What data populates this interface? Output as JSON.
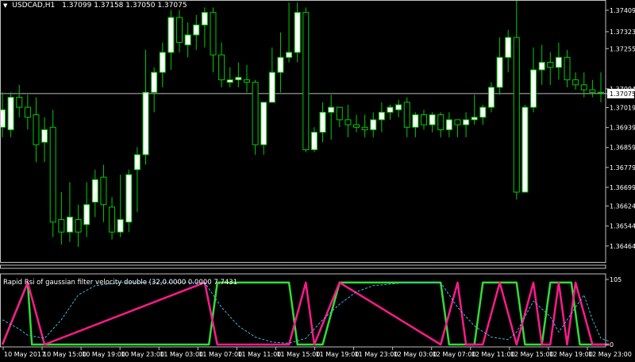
{
  "header": {
    "symbol": "USDCAD,H1",
    "ohlc": "1.37099 1.37158 1.37050 1.37075"
  },
  "indicator": {
    "title": "Rapid Rsi of gaussian filter velocity double (32,0.0000 0.0000 7.7431"
  },
  "colors": {
    "background": "#000000",
    "bull_candle": "#ffffff",
    "bear_candle": "#000000",
    "wick": "#00cc00",
    "rsi_up": "#33dd33",
    "rsi_down": "#ff1a8c",
    "signal": "#3fb7d9",
    "grid": "#c0c0c0"
  },
  "chart_data": [
    {
      "type": "candlestick",
      "title": "USDCAD,H1",
      "ylim": [
        1.364,
        1.3745
      ],
      "yticks": [
        "1.37409",
        "1.37323",
        "1.37255",
        "1.37094",
        "1.37075",
        "1.37019",
        "1.36939",
        "1.36859",
        "1.36779",
        "1.36699",
        "1.36624",
        "1.36544",
        "1.36464"
      ],
      "current_price": "1.37075",
      "xticks": [
        "10 May 2017",
        "10 May 15:00",
        "10 May 19:00",
        "10 May 23:00",
        "11 May 03:00",
        "11 May 07:00",
        "11 May 11:00",
        "11 May 15:00",
        "11 May 19:00",
        "11 May 23:00",
        "12 May 03:00",
        "12 May 07:00",
        "12 May 11:00",
        "12 May 15:00",
        "12 May 19:00",
        "12 May 23:00"
      ],
      "candles": [
        {
          "o": 1.3694,
          "h": 1.3708,
          "l": 1.369,
          "c": 1.3701
        },
        {
          "o": 1.3693,
          "h": 1.3708,
          "l": 1.369,
          "c": 1.3706
        },
        {
          "o": 1.3706,
          "h": 1.3711,
          "l": 1.3698,
          "c": 1.3702
        },
        {
          "o": 1.3702,
          "h": 1.3707,
          "l": 1.3693,
          "c": 1.3698
        },
        {
          "o": 1.3699,
          "h": 1.3706,
          "l": 1.368,
          "c": 1.3687
        },
        {
          "o": 1.3688,
          "h": 1.3698,
          "l": 1.368,
          "c": 1.3693
        },
        {
          "o": 1.3694,
          "h": 1.3701,
          "l": 1.365,
          "c": 1.3656
        },
        {
          "o": 1.3657,
          "h": 1.3668,
          "l": 1.3647,
          "c": 1.3652
        },
        {
          "o": 1.3652,
          "h": 1.3672,
          "l": 1.3648,
          "c": 1.3658
        },
        {
          "o": 1.3657,
          "h": 1.3663,
          "l": 1.3646,
          "c": 1.3652
        },
        {
          "o": 1.3655,
          "h": 1.3672,
          "l": 1.365,
          "c": 1.3663
        },
        {
          "o": 1.3664,
          "h": 1.3677,
          "l": 1.3658,
          "c": 1.3673
        },
        {
          "o": 1.3674,
          "h": 1.3679,
          "l": 1.3656,
          "c": 1.3663
        },
        {
          "o": 1.3662,
          "h": 1.3666,
          "l": 1.3649,
          "c": 1.3652
        },
        {
          "o": 1.3652,
          "h": 1.3675,
          "l": 1.365,
          "c": 1.3657
        },
        {
          "o": 1.3656,
          "h": 1.3677,
          "l": 1.3652,
          "c": 1.3675
        },
        {
          "o": 1.3677,
          "h": 1.3686,
          "l": 1.366,
          "c": 1.3683
        },
        {
          "o": 1.3683,
          "h": 1.3725,
          "l": 1.3679,
          "c": 1.3708
        },
        {
          "o": 1.3708,
          "h": 1.3718,
          "l": 1.37,
          "c": 1.3716
        },
        {
          "o": 1.3716,
          "h": 1.3728,
          "l": 1.371,
          "c": 1.3724
        },
        {
          "o": 1.3724,
          "h": 1.3741,
          "l": 1.3717,
          "c": 1.3738
        },
        {
          "o": 1.3738,
          "h": 1.3741,
          "l": 1.3724,
          "c": 1.3728
        },
        {
          "o": 1.3727,
          "h": 1.3736,
          "l": 1.3722,
          "c": 1.3731
        },
        {
          "o": 1.3731,
          "h": 1.3739,
          "l": 1.3725,
          "c": 1.3735
        },
        {
          "o": 1.3735,
          "h": 1.3742,
          "l": 1.3726,
          "c": 1.374
        },
        {
          "o": 1.374,
          "h": 1.3742,
          "l": 1.3716,
          "c": 1.3723
        },
        {
          "o": 1.3723,
          "h": 1.3728,
          "l": 1.371,
          "c": 1.3713
        },
        {
          "o": 1.3712,
          "h": 1.3718,
          "l": 1.371,
          "c": 1.3713
        },
        {
          "o": 1.3713,
          "h": 1.372,
          "l": 1.371,
          "c": 1.3714
        },
        {
          "o": 1.3713,
          "h": 1.3719,
          "l": 1.3708,
          "c": 1.3712
        },
        {
          "o": 1.3712,
          "h": 1.3713,
          "l": 1.3683,
          "c": 1.3687
        },
        {
          "o": 1.3687,
          "h": 1.3698,
          "l": 1.3683,
          "c": 1.3704
        },
        {
          "o": 1.3704,
          "h": 1.3726,
          "l": 1.3704,
          "c": 1.3716
        },
        {
          "o": 1.3716,
          "h": 1.3732,
          "l": 1.3708,
          "c": 1.3722
        },
        {
          "o": 1.3722,
          "h": 1.3744,
          "l": 1.372,
          "c": 1.3724
        },
        {
          "o": 1.3724,
          "h": 1.3744,
          "l": 1.372,
          "c": 1.374
        },
        {
          "o": 1.374,
          "h": 1.3742,
          "l": 1.3684,
          "c": 1.3685
        },
        {
          "o": 1.3685,
          "h": 1.3694,
          "l": 1.3684,
          "c": 1.3692
        },
        {
          "o": 1.3692,
          "h": 1.3704,
          "l": 1.3688,
          "c": 1.37
        },
        {
          "o": 1.37,
          "h": 1.3707,
          "l": 1.3689,
          "c": 1.3702
        },
        {
          "o": 1.3702,
          "h": 1.3702,
          "l": 1.3694,
          "c": 1.3697
        },
        {
          "o": 1.3697,
          "h": 1.3703,
          "l": 1.369,
          "c": 1.3695
        },
        {
          "o": 1.3695,
          "h": 1.3699,
          "l": 1.3692,
          "c": 1.3694
        },
        {
          "o": 1.3694,
          "h": 1.3699,
          "l": 1.369,
          "c": 1.3693
        },
        {
          "o": 1.3693,
          "h": 1.37,
          "l": 1.369,
          "c": 1.3697
        },
        {
          "o": 1.3697,
          "h": 1.3704,
          "l": 1.3692,
          "c": 1.37
        },
        {
          "o": 1.37,
          "h": 1.3703,
          "l": 1.3697,
          "c": 1.3702
        },
        {
          "o": 1.3701,
          "h": 1.3705,
          "l": 1.3698,
          "c": 1.3703
        },
        {
          "o": 1.3704,
          "h": 1.3706,
          "l": 1.369,
          "c": 1.3694
        },
        {
          "o": 1.3694,
          "h": 1.37,
          "l": 1.369,
          "c": 1.3699
        },
        {
          "o": 1.3699,
          "h": 1.3701,
          "l": 1.3693,
          "c": 1.3695
        },
        {
          "o": 1.3695,
          "h": 1.37,
          "l": 1.3692,
          "c": 1.3699
        },
        {
          "o": 1.3699,
          "h": 1.37,
          "l": 1.369,
          "c": 1.3693
        },
        {
          "o": 1.3693,
          "h": 1.37,
          "l": 1.369,
          "c": 1.3697
        },
        {
          "o": 1.3697,
          "h": 1.3697,
          "l": 1.369,
          "c": 1.3695
        },
        {
          "o": 1.3695,
          "h": 1.37,
          "l": 1.369,
          "c": 1.3697
        },
        {
          "o": 1.3697,
          "h": 1.3707,
          "l": 1.3695,
          "c": 1.3698
        },
        {
          "o": 1.3698,
          "h": 1.3703,
          "l": 1.3695,
          "c": 1.3702
        },
        {
          "o": 1.3702,
          "h": 1.3712,
          "l": 1.37,
          "c": 1.371
        },
        {
          "o": 1.371,
          "h": 1.373,
          "l": 1.3707,
          "c": 1.3722
        },
        {
          "o": 1.3722,
          "h": 1.3733,
          "l": 1.3716,
          "c": 1.373
        },
        {
          "o": 1.373,
          "h": 1.3746,
          "l": 1.3665,
          "c": 1.3668
        },
        {
          "o": 1.3668,
          "h": 1.3703,
          "l": 1.3668,
          "c": 1.3702
        },
        {
          "o": 1.3702,
          "h": 1.3726,
          "l": 1.37,
          "c": 1.3717
        },
        {
          "o": 1.3717,
          "h": 1.3727,
          "l": 1.3711,
          "c": 1.372
        },
        {
          "o": 1.372,
          "h": 1.3724,
          "l": 1.3711,
          "c": 1.3718
        },
        {
          "o": 1.3718,
          "h": 1.3728,
          "l": 1.3713,
          "c": 1.3722
        },
        {
          "o": 1.3722,
          "h": 1.3725,
          "l": 1.371,
          "c": 1.3713
        },
        {
          "o": 1.3713,
          "h": 1.3716,
          "l": 1.3709,
          "c": 1.3711
        },
        {
          "o": 1.3711,
          "h": 1.3716,
          "l": 1.3706,
          "c": 1.3709
        },
        {
          "o": 1.3709,
          "h": 1.3713,
          "l": 1.3706,
          "c": 1.3708
        },
        {
          "o": 1.3708,
          "h": 1.3716,
          "l": 1.3704,
          "c": 1.3708
        }
      ]
    },
    {
      "type": "line",
      "title": "Rapid Rsi of gaussian filter velocity double (32,0.0000 0.0000 7.7431",
      "ylim": [
        0,
        105
      ],
      "yticks": [
        "105",
        "0"
      ],
      "series": [
        {
          "color": "rsi_up",
          "points": [
            [
              0,
              0
            ],
            [
              3,
              100
            ],
            [
              3.5,
              0
            ],
            [
              24.5,
              0
            ],
            [
              25.5,
              100
            ],
            [
              34,
              100
            ],
            [
              35,
              0
            ],
            [
              38,
              0
            ],
            [
              40,
              100
            ],
            [
              52,
              100
            ],
            [
              53,
              0
            ],
            [
              56,
              0
            ],
            [
              57,
              100
            ],
            [
              61,
              100
            ],
            [
              62,
              0
            ],
            [
              64,
              0
            ],
            [
              65,
              100
            ],
            [
              67.5,
              100
            ],
            [
              68.5,
              0
            ],
            [
              72,
              0
            ]
          ]
        },
        {
          "color": "rsi_down",
          "points": [
            [
              0,
              0
            ],
            [
              3,
              100
            ],
            [
              5,
              0
            ],
            [
              24,
              100
            ],
            [
              25.5,
              0
            ],
            [
              34,
              0
            ],
            [
              36,
              100
            ],
            [
              37,
              0
            ],
            [
              40,
              100
            ],
            [
              52,
              0
            ],
            [
              54,
              100
            ],
            [
              55,
              0
            ],
            [
              57,
              0
            ],
            [
              59,
              100
            ],
            [
              61,
              0
            ],
            [
              63,
              100
            ],
            [
              64,
              0
            ],
            [
              65,
              0
            ],
            [
              66,
              100
            ],
            [
              67,
              0
            ],
            [
              68,
              100
            ],
            [
              70,
              0
            ],
            [
              72,
              0
            ]
          ]
        },
        {
          "color": "signal",
          "dashed": true,
          "points": [
            [
              0,
              40
            ],
            [
              2,
              25
            ],
            [
              3,
              15
            ],
            [
              5,
              10
            ],
            [
              7,
              40
            ],
            [
              9,
              80
            ],
            [
              11,
              95
            ],
            [
              14,
              100
            ],
            [
              24,
              100
            ],
            [
              26,
              60
            ],
            [
              28,
              30
            ],
            [
              30,
              12
            ],
            [
              32,
              4
            ],
            [
              34,
              2
            ],
            [
              36,
              10
            ],
            [
              38,
              40
            ],
            [
              40,
              65
            ],
            [
              42,
              85
            ],
            [
              44,
              95
            ],
            [
              48,
              100
            ],
            [
              52,
              100
            ],
            [
              54,
              60
            ],
            [
              56,
              30
            ],
            [
              58,
              12
            ],
            [
              60,
              8
            ],
            [
              61,
              20
            ],
            [
              63,
              70
            ],
            [
              65,
              45
            ],
            [
              66,
              20
            ],
            [
              68,
              60
            ],
            [
              69,
              80
            ],
            [
              70,
              40
            ],
            [
              71,
              10
            ],
            [
              72,
              5
            ]
          ]
        }
      ]
    }
  ]
}
